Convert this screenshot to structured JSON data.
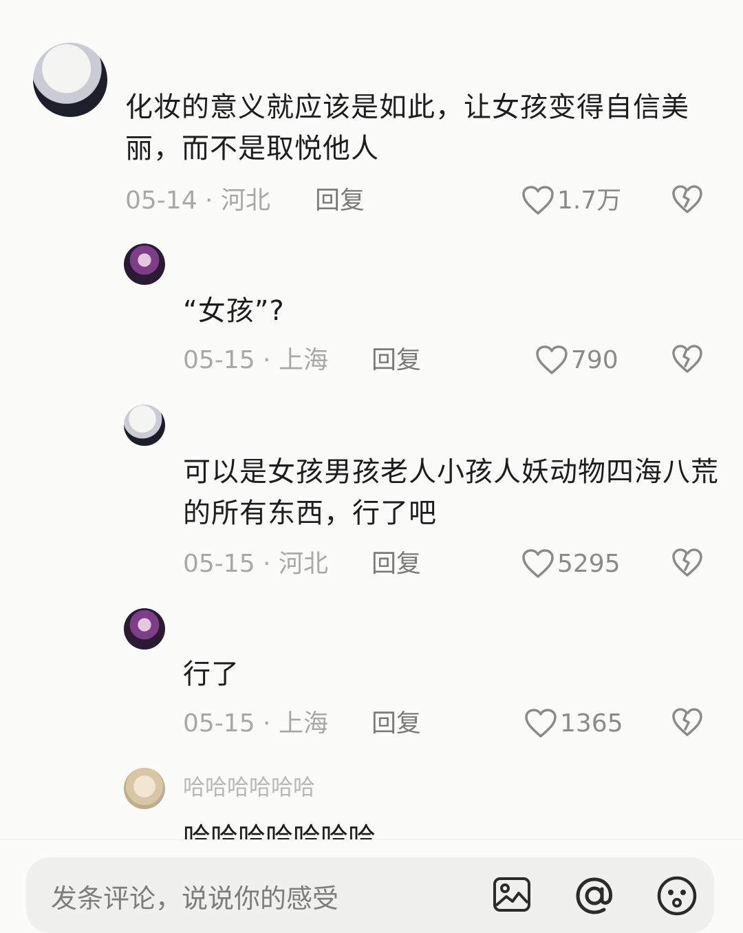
{
  "comments": [
    {
      "avatar": "white-haired-anime-avatar",
      "text": "化妆的意义就应该是如此，让女孩变得自信美丽，而不是取悦他人",
      "meta": "05-14 · 河北",
      "reply": "回复",
      "likes": "1.7万"
    },
    {
      "avatar": "purple-portrait-avatar",
      "text": "“女孩”?",
      "meta": "05-15 · 上海",
      "reply": "回复",
      "likes": "790"
    },
    {
      "avatar": "white-haired-anime-avatar",
      "text": "可以是女孩男孩老人小孩人妖动物四海八荒的所有东西，行了吧",
      "meta": "05-15 · 河北",
      "reply": "回复",
      "likes": "5295"
    },
    {
      "avatar": "purple-portrait-avatar",
      "text": "行了",
      "meta": "05-15 · 上海",
      "reply": "回复",
      "likes": "1365"
    },
    {
      "avatar": "beige-avatar",
      "username": "哈哈哈哈哈哈",
      "text": "哈哈哈哈哈哈哈"
    }
  ],
  "composer": {
    "placeholder": "发条评论，说说你的感受",
    "icons": [
      "image-icon",
      "at-icon",
      "emoji-icon"
    ]
  }
}
